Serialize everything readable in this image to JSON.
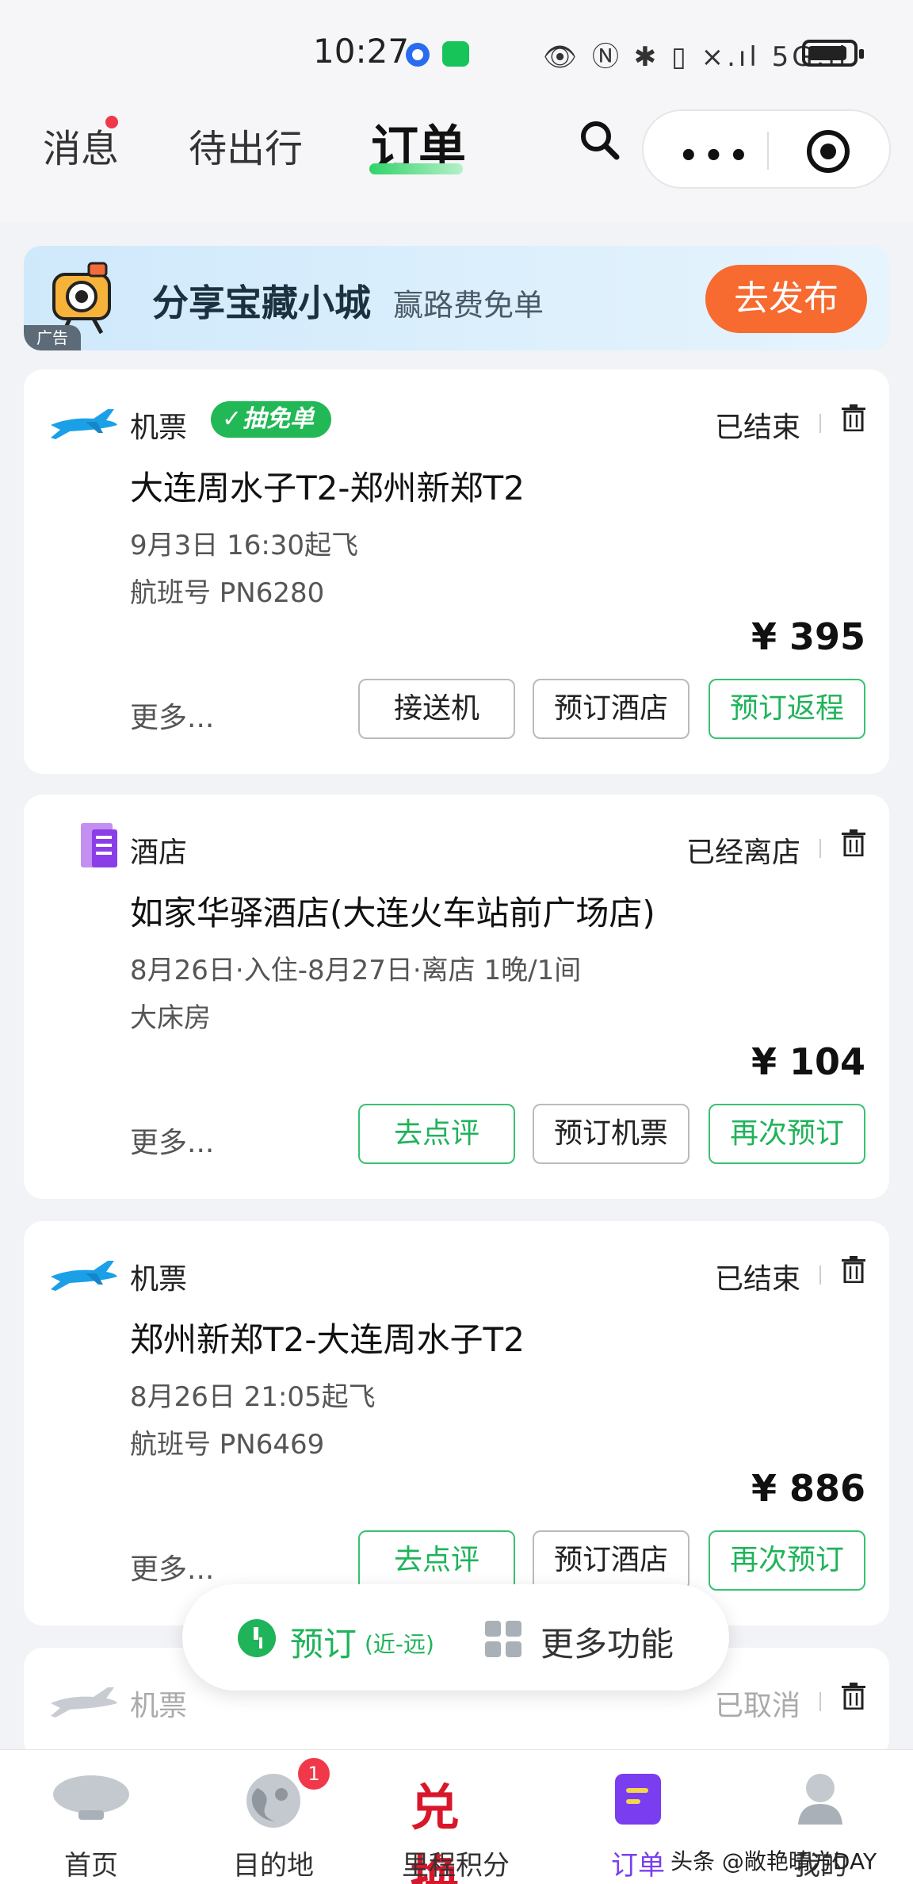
{
  "status_bar": {
    "time": "10:27",
    "icons": "👁 Ⓝ ✱ ▯ ×.ıl 5G.ıl"
  },
  "header": {
    "tabs": [
      {
        "label": "消息"
      },
      {
        "label": "待出行"
      },
      {
        "label": "订单"
      }
    ],
    "active_tab": "订单",
    "more_icon": "•••"
  },
  "ad": {
    "title": "分享宝藏小城",
    "subtitle": "赢路费免单",
    "button": "去发布",
    "badge": "广告"
  },
  "orders": [
    {
      "type": "机票",
      "badge": "抽免单",
      "status": "已结束",
      "title": "大连周水子T2-郑州新郑T2",
      "line1": "9月3日 16:30起飞",
      "line2": "航班号 PN6280",
      "price": "¥ 395",
      "more": "更多...",
      "buttons": [
        "接送机",
        "预订酒店",
        "预订返程"
      ]
    },
    {
      "type": "酒店",
      "status": "已经离店",
      "title": "如家华驿酒店(大连火车站前广场店)",
      "line1": "8月26日·入住-8月27日·离店 1晚/1间",
      "line2": "大床房",
      "price": "¥ 104",
      "more": "更多...",
      "buttons": [
        "去点评",
        "预订机票",
        "再次预订"
      ]
    },
    {
      "type": "机票",
      "status": "已结束",
      "title": "郑州新郑T2-大连周水子T2",
      "line1": "8月26日 21:05起飞",
      "line2": "航班号 PN6469",
      "price": "¥ 886",
      "more": "更多...",
      "buttons": [
        "去点评",
        "预订酒店",
        "再次预订"
      ]
    },
    {
      "type": "机票",
      "status": "已取消"
    }
  ],
  "floating_bar": {
    "book_label": "预订",
    "book_sub": "(近-远)",
    "more_label": "更多功能"
  },
  "tabbar": {
    "items": [
      {
        "label": "首页"
      },
      {
        "label": "目的地",
        "badge": "1"
      },
      {
        "label": "里程积分",
        "icon_text": "兑换"
      },
      {
        "label": "订单"
      },
      {
        "label": "我的"
      }
    ]
  },
  "watermark": "头条 @敞艳晴方DAY",
  "colors": {
    "accent_green": "#1fb35a",
    "ad_button": "#f76a30",
    "active_purple": "#7a3df0",
    "badge_red": "#f0384a"
  }
}
